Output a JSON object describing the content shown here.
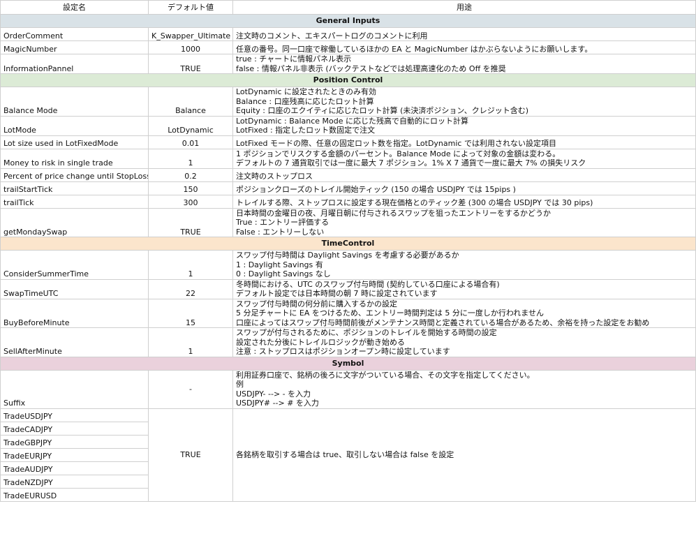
{
  "headers": [
    "設定名",
    "デフォルト値",
    "用途"
  ],
  "sections": {
    "general": "General Inputs",
    "position": "Position Control",
    "time": "TimeControl",
    "symbol": "Symbol"
  },
  "general_rows": [
    {
      "name": "OrderComment",
      "default": "K_Swapper_Ultimate",
      "desc": [
        "注文時のコメント、エキスパートログのコメントに利用"
      ]
    },
    {
      "name": "MagicNumber",
      "default": "1000",
      "desc": [
        "任意の番号。同一口座で稼働しているほかの EA と MagicNumber はかぶらないようにお願いします。"
      ]
    },
    {
      "name": "InformationPannel",
      "default": "TRUE",
      "desc": [
        "true : チャートに情報パネル表示",
        "false : 情報パネル非表示 (バックテストなどでは処理高速化のため Off を推奨"
      ]
    }
  ],
  "position_rows": [
    {
      "name": "Balance Mode",
      "default": "Balance",
      "desc": [
        "LotDynamic に設定されたときのみ有効",
        "Balance : 口座残高に応じたロット計算",
        "Equity : 口座のエクイティに応じたロット計算 (未決済ポジション、クレジット含む)"
      ]
    },
    {
      "name": "LotMode",
      "default": "LotDynamic",
      "desc": [
        "LotDynamic : Balance Mode に応じた残高で自動的にロット計算",
        "LotFixed : 指定したロット数固定で注文"
      ]
    },
    {
      "name": "Lot size used in LotFixedMode",
      "default": "0.01",
      "desc": [
        "LotFixed モードの際、任意の固定ロット数を指定。LotDynamic では利用されない設定項目"
      ]
    },
    {
      "name": "Money to risk in single trade",
      "default": "1",
      "desc": [
        "1 ポジションでリスクする金額のパーセント。Balance Mode によって対象の金額は変わる。",
        "デフォルトの 7 通貨取引では一度に最大 7 ポジション。1% X 7 通貨で一度に最大 7% の損失リスク"
      ]
    },
    {
      "name": "Percent of price change until StopLoss",
      "default": "0.2",
      "desc": [
        "注文時のストップロス"
      ]
    },
    {
      "name": "trailStartTick",
      "default": "150",
      "desc": [
        "ポジションクローズのトレイル開始ティック (150 の場合 USDJPY では 15pips )"
      ]
    },
    {
      "name": "trailTick",
      "default": "300",
      "desc": [
        "トレイルする際、ストップロスに設定する現在価格とのティック差 (300 の場合 USDJPY では 30 pips)"
      ]
    },
    {
      "name": "getMondaySwap",
      "default": "TRUE",
      "desc": [
        "日本時間の金曜日の夜、月曜日朝に付与されるスワップを狙ったエントリーをするかどうか",
        "True : エントリー評価する",
        "False : エントリーしない"
      ]
    }
  ],
  "time_rows": [
    {
      "name": "ConsiderSummerTime",
      "default": "1",
      "desc": [
        "スワップ付与時間は Daylight Savings を考慮する必要があるか",
        "1 : Daylight Savings 有",
        "0 : Daylight Savings なし"
      ]
    },
    {
      "name": "SwapTimeUTC",
      "default": "22",
      "desc": [
        "冬時間における、UTC のスワップ付与時間 (契約している口座による場合有)",
        "デフォルト設定では日本時間の朝 7 時に設定されています"
      ]
    },
    {
      "name": "BuyBeforeMinute",
      "default": "15",
      "desc": [
        "スワップ付与時間の何分前に購入するかの設定",
        "5 分足チャートに EA をつけるため、エントリー時間判定は 5 分に一度しか行われません",
        "口座によってはスワップ付与時間前後がメンテナンス時間と定義されている場合があるため、余裕を持った設定をお勧め"
      ]
    },
    {
      "name": "SellAfterMinute",
      "default": "1",
      "desc": [
        "スワップが付与されるために、ポジションのトレイルを開始する時間の設定",
        "設定された分後にトレイルロジックが動き始める",
        "注意 : ストップロスはポジションオープン時に設定しています"
      ]
    }
  ],
  "symbol": {
    "suffix": {
      "name": "Suffix",
      "default": "-",
      "desc": [
        "利用証券口座で、銘柄の後ろに文字がついている場合、その文字を指定してください。",
        "例",
        "USDJPY-  --> - を入力",
        "USDJPY# --> # を入力"
      ]
    },
    "trade_names": [
      "TradeUSDJPY",
      "TradeCADJPY",
      "TradeGBPJPY",
      "TradeEURJPY",
      "TradeAUDJPY",
      "TradeNZDJPY",
      "TradeEURUSD"
    ],
    "trade_default": "TRUE",
    "trade_desc": "各銘柄を取引する場合は true、取引しない場合は false を設定"
  }
}
